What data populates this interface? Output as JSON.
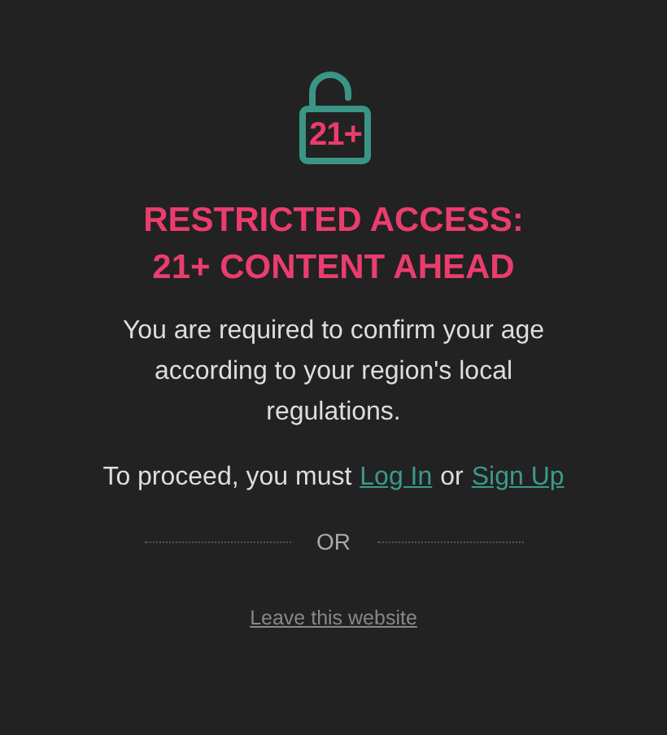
{
  "badge": "21+",
  "title": "RESTRICTED ACCESS: 21+ CONTENT AHEAD",
  "message": "You are required to confirm your age according to your region's local regulations.",
  "proceed": {
    "text": "To proceed, you must",
    "links": [
      {
        "kind": "link",
        "label": "Log In"
      },
      {
        "kind": "text",
        "label": "or"
      },
      {
        "kind": "link",
        "label": "Sign Up"
      }
    ]
  },
  "divider": "OR",
  "leave_link": "Leave this website"
}
